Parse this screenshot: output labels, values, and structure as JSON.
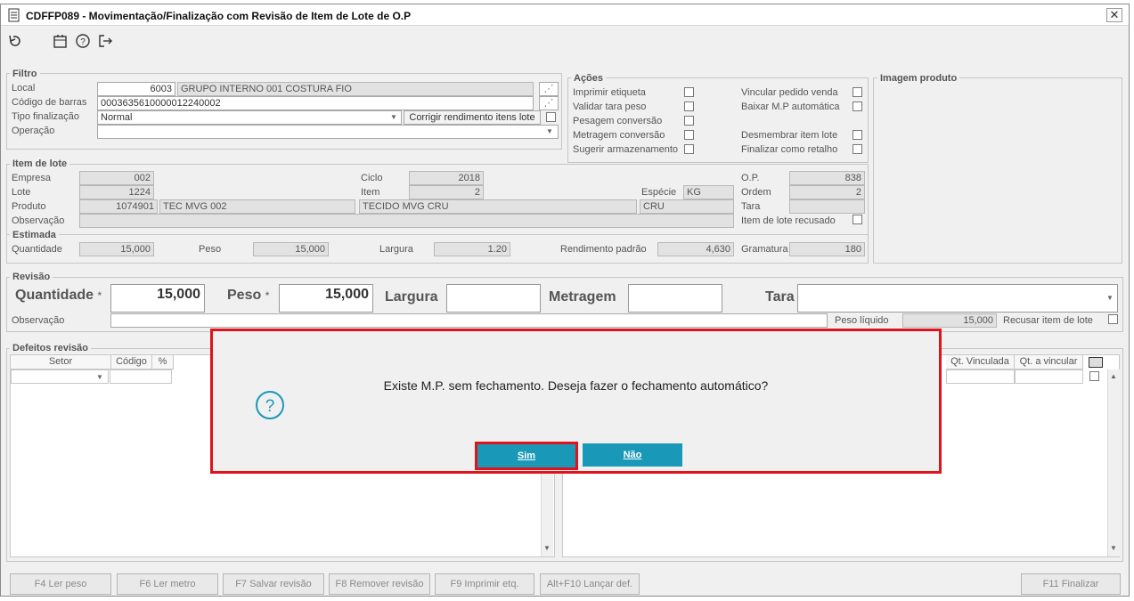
{
  "window": {
    "title": "CDFFP089 - Movimentação/Finalização com Revisão de Item de Lote de O.P",
    "close_label": "✕"
  },
  "toolbar": {
    "icons": [
      "refresh-icon",
      "calendar-icon",
      "help-icon",
      "exit-icon"
    ]
  },
  "filtro": {
    "title": "Filtro",
    "local_label": "Local",
    "local_code": "6003",
    "local_name": "GRUPO INTERNO 001 COSTURA FIO",
    "barcode_label": "Código de barras",
    "barcode_value": "00036356100000122400​02",
    "tipo_label": "Tipo finalização",
    "tipo_value": "Normal",
    "corrigir_label": "Corrigir rendimento itens lote",
    "operacao_label": "Operação",
    "operacao_value": ""
  },
  "acoes": {
    "title": "Ações",
    "left": [
      "Imprimir etiqueta",
      "Validar tara peso",
      "Pesagem conversão",
      "Metragem conversão",
      "Sugerir armazenamento"
    ],
    "right": [
      "Vincular pedido venda",
      "Baixar M.P automática",
      "Desmembrar item lote",
      "Finalizar como retalho"
    ]
  },
  "imagem": {
    "title": "Imagem produto"
  },
  "item": {
    "title": "Item de lote",
    "empresa_label": "Empresa",
    "empresa": "002",
    "lote_label": "Lote",
    "lote": "1224",
    "produto_label": "Produto",
    "produto_code": "1074901",
    "produto_name": "TEC MVG 002",
    "produto_desc": "TECIDO MVG CRU",
    "produto_cor": "CRU",
    "obs_label": "Observação",
    "ciclo_label": "Ciclo",
    "ciclo": "2018",
    "item_label": "Item",
    "item": "2",
    "especie_label": "Espécie",
    "especie": "KG",
    "op_label": "O.P.",
    "op": "838",
    "ordem_label": "Ordem",
    "ordem": "2",
    "tara_label": "Tara",
    "tara": "",
    "recusado_label": "Item de lote recusado"
  },
  "estimada": {
    "title": "Estimada",
    "quantidade_label": "Quantidade",
    "quantidade": "15,000",
    "peso_label": "Peso",
    "peso": "15,000",
    "largura_label": "Largura",
    "largura": "1.20",
    "rendimento_label": "Rendimento padrão",
    "rendimento": "4,630",
    "gramatura_label": "Gramatura",
    "gramatura": "180"
  },
  "revisao": {
    "title": "Revisão",
    "quantidade_label": "Quantidade",
    "quantidade": "15,000",
    "peso_label": "Peso",
    "peso": "15,000",
    "largura_label": "Largura",
    "largura": "",
    "metragem_label": "Metragem",
    "metragem": "",
    "tara_label": "Tara",
    "tara": "",
    "required_mark": "*",
    "obs_label": "Observação",
    "peso_liquido_label": "Peso líquido",
    "peso_liquido": "15,000",
    "recusar_label": "Recusar item de lote"
  },
  "defeitos": {
    "title": "Defeitos revisão",
    "left_columns": [
      "Setor",
      "Código",
      "%"
    ],
    "right_columns": [
      "Qt. Vinculada",
      "Qt. a vincular"
    ]
  },
  "fkeys": [
    "F4 Ler peso",
    "F6 Ler metro",
    "F7 Salvar revisão",
    "F8 Remover revisão",
    "F9 Imprimir etq.",
    "Alt+F10 Lançar def.",
    "F11 Finalizar"
  ],
  "dialog": {
    "message": "Existe M.P. sem fechamento. Deseja fazer o fechamento automático?",
    "icon": "question-icon",
    "yes_label": "Sim",
    "no_label": "Não"
  },
  "colors": {
    "accent": "#1a98b8",
    "highlight": "#e0121b"
  }
}
